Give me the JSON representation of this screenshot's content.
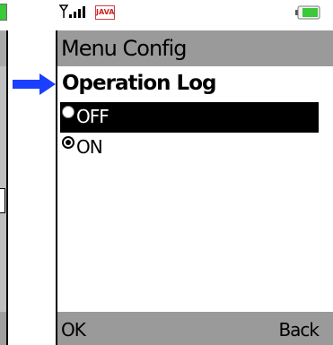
{
  "left_screen": {
    "battery_color": "#39c939"
  },
  "annotation": {
    "arrow_color": "#1a3fff",
    "arrow_icon": "right-arrow-icon"
  },
  "status_bar": {
    "signal_icon": "signal-strength-icon",
    "java_badge": "JAVA",
    "battery_icon": "battery-icon",
    "battery_color": "#39c939"
  },
  "title_bar": {
    "title": "Menu Config",
    "background": "#9a9a9a"
  },
  "form": {
    "group_label": "Operation Log",
    "options": [
      {
        "label": "OFF",
        "checked": false,
        "highlighted": true
      },
      {
        "label": "ON",
        "checked": true,
        "highlighted": false
      }
    ]
  },
  "soft_keys": {
    "left": "OK",
    "right": "Back"
  }
}
